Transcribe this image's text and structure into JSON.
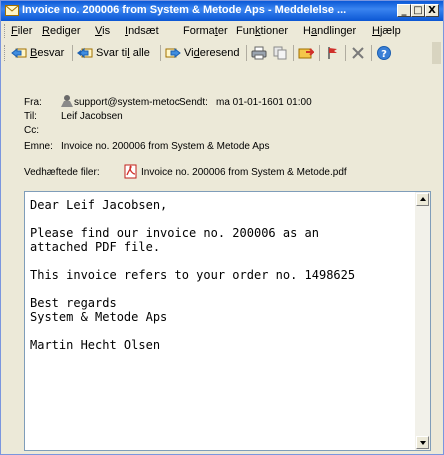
{
  "window": {
    "title": "Invoice no. 200006 from System & Metode Aps - Meddelelse ...",
    "minimize_glyph": "_",
    "maximize_glyph": "□",
    "close_glyph": "X"
  },
  "menu": {
    "items": [
      {
        "mnemonic": "F",
        "rest": "iler"
      },
      {
        "mnemonic": "R",
        "rest": "ediger"
      },
      {
        "mnemonic": "V",
        "rest": "is"
      },
      {
        "mnemonic": "I",
        "rest": "ndsæt"
      },
      {
        "pre": "Forma",
        "mnemonic": "t",
        "rest": "er"
      },
      {
        "pre": "Fun",
        "mnemonic": "k",
        "rest": "tioner"
      },
      {
        "pre": "H",
        "mnemonic": "a",
        "rest": "ndlinger"
      },
      {
        "mnemonic": "H",
        "rest": "jælp"
      }
    ]
  },
  "toolbar": {
    "reply_pre": "",
    "reply_mnemonic": "B",
    "reply_rest": "esvar",
    "reply_all_pre": "Svar ti",
    "reply_all_mnemonic": "l",
    "reply_all_rest": " alle",
    "forward_pre": "Vi",
    "forward_mnemonic": "d",
    "forward_rest": "eresend"
  },
  "header": {
    "from_label": "Fra:",
    "from_value": "support@system-metoc",
    "sent_label": "Sendt:",
    "sent_value": "ma 01-01-1601 01:00",
    "to_label": "Til:",
    "to_value": "Leif Jacobsen",
    "cc_label": "Cc:",
    "subject_label": "Emne:",
    "subject_value": "Invoice no. 200006 from System & Metode Aps",
    "attach_label": "Vedhæftede filer:",
    "attach_value": "Invoice no. 200006 from System & Metode.pdf"
  },
  "body": {
    "text": "Dear Leif Jacobsen,\n\nPlease find our invoice no. 200006 as an\nattached PDF file.\n\nThis invoice refers to your order no. 1498625\n\nBest regards\nSystem & Metode Aps\n\nMartin Hecht Olsen"
  },
  "colors": {
    "titlebar": "#0a58d6",
    "chrome": "#ece9d8",
    "body_border": "#7f9db9"
  }
}
